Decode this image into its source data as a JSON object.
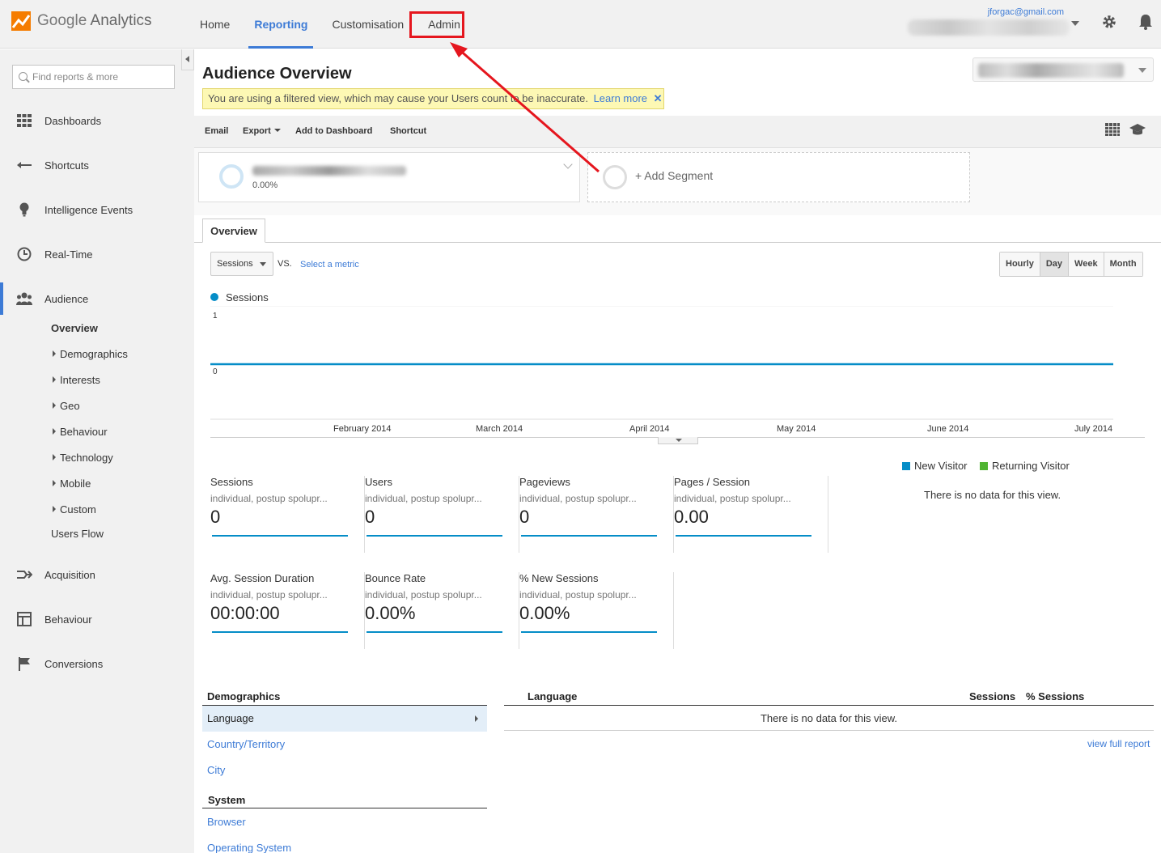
{
  "app": {
    "logo_text": "Google Analytics",
    "logo_google": "Google",
    "logo_analytics": "Analytics"
  },
  "topnav": [
    {
      "label": "Home"
    },
    {
      "label": "Reporting"
    },
    {
      "label": "Customisation"
    },
    {
      "label": "Admin"
    }
  ],
  "account": {
    "email": "jforgac@gmail.com"
  },
  "sidebar": {
    "search_placeholder": "Find reports & more",
    "items": [
      {
        "label": "Dashboards"
      },
      {
        "label": "Shortcuts"
      },
      {
        "label": "Intelligence Events"
      },
      {
        "label": "Real-Time"
      },
      {
        "label": "Audience"
      },
      {
        "label": "Acquisition"
      },
      {
        "label": "Behaviour"
      },
      {
        "label": "Conversions"
      }
    ],
    "audience_sub": [
      {
        "label": "Overview"
      },
      {
        "label": "Demographics"
      },
      {
        "label": "Interests"
      },
      {
        "label": "Geo"
      },
      {
        "label": "Behaviour"
      },
      {
        "label": "Technology"
      },
      {
        "label": "Mobile"
      },
      {
        "label": "Custom"
      },
      {
        "label": "Users Flow"
      }
    ]
  },
  "main": {
    "title": "Audience Overview",
    "warning": "You are using a filtered view, which may cause your Users count to be inaccurate.",
    "warning_link": "Learn more",
    "warning_close": "✕",
    "toolbar": {
      "email": "Email",
      "export": "Export",
      "add_dashboard": "Add to Dashboard",
      "shortcut": "Shortcut"
    },
    "segment": {
      "pct": "0.00%",
      "add_label": "+ Add Segment"
    },
    "tab": "Overview",
    "metric": "Sessions",
    "vs": "VS.",
    "select_metric": "Select a metric",
    "time_buttons": [
      "Hourly",
      "Day",
      "Week",
      "Month"
    ],
    "legend": "Sessions"
  },
  "chart_data": {
    "type": "line",
    "series": [
      {
        "name": "Sessions",
        "values": [
          0,
          0,
          0,
          0,
          0,
          0
        ]
      }
    ],
    "x": [
      "February 2014",
      "March 2014",
      "April 2014",
      "May 2014",
      "June 2014",
      "July 2014"
    ],
    "ylim": [
      0,
      1
    ],
    "y_ticks": [
      "1",
      "0"
    ],
    "color": "#058dc7"
  },
  "scorecards": [
    {
      "name": "Sessions",
      "sub": "individual, postup spolupr...",
      "value": "0"
    },
    {
      "name": "Users",
      "sub": "individual, postup spolupr...",
      "value": "0"
    },
    {
      "name": "Pageviews",
      "sub": "individual, postup spolupr...",
      "value": "0"
    },
    {
      "name": "Pages / Session",
      "sub": "individual, postup spolupr...",
      "value": "0.00"
    },
    {
      "name": "Avg. Session Duration",
      "sub": "individual, postup spolupr...",
      "value": "00:00:00"
    },
    {
      "name": "Bounce Rate",
      "sub": "individual, postup spolupr...",
      "value": "0.00%"
    },
    {
      "name": "% New Sessions",
      "sub": "individual, postup spolupr...",
      "value": "0.00%"
    }
  ],
  "pie": {
    "legend": [
      {
        "label": "New Visitor",
        "color": "#058dc7"
      },
      {
        "label": "Returning Visitor",
        "color": "#50b432"
      }
    ],
    "no_data": "There is no data for this view."
  },
  "demographics": {
    "title": "Demographics",
    "items": [
      "Language",
      "Country/Territory",
      "City"
    ],
    "system_title": "System",
    "system_items": [
      "Browser",
      "Operating System"
    ]
  },
  "language_table": {
    "headers": [
      "Language",
      "Sessions",
      "% Sessions"
    ],
    "no_data": "There is no data for this view.",
    "view_full": "view full report"
  }
}
